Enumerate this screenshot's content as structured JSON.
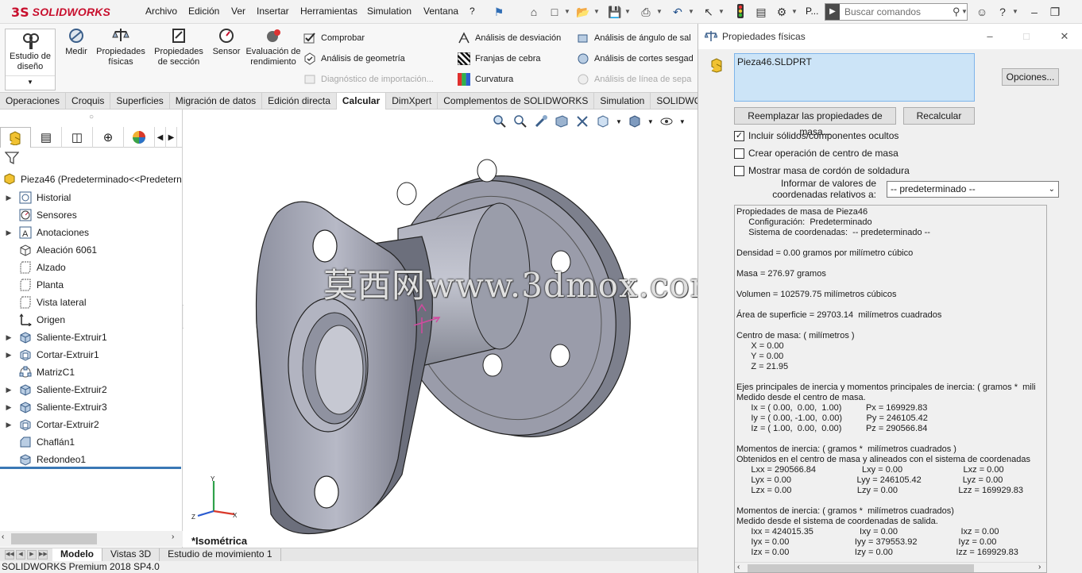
{
  "app": {
    "brand": "SOLIDWORKS",
    "logo_mark": "3S"
  },
  "menu": [
    "Archivo",
    "Edición",
    "Ver",
    "Insertar",
    "Herramientas",
    "Simulation",
    "Ventana",
    "?"
  ],
  "search": {
    "placeholder": "Buscar comandos"
  },
  "quick_label": "P...",
  "command_manager": {
    "estudio": "Estudio de diseño",
    "medir": "Medir",
    "propiedades_fisicas": "Propiedades físicas",
    "propiedades_seccion": "Propiedades de sección",
    "sensor": "Sensor",
    "evaluacion": "Evaluación de rendimiento",
    "col1": [
      "Comprobar",
      "Análisis de geometría",
      "Diagnóstico de importación..."
    ],
    "col2": [
      "Análisis de desviación",
      "Franjas de cebra",
      "Curvatura"
    ],
    "col3": [
      "Análisis de ángulo de sal",
      "Análisis de cortes sesgad",
      "Análisis de línea de sepa"
    ]
  },
  "command_tabs": [
    "Operaciones",
    "Croquis",
    "Superficies",
    "Migración de datos",
    "Edición directa",
    "Calcular",
    "DimXpert",
    "Complementos de SOLIDWORKS",
    "Simulation",
    "SOLIDWOR"
  ],
  "active_command_tab": "Calcular",
  "tree": {
    "root": "Pieza46  (Predeterminado<<Predetern",
    "items": [
      {
        "label": "Historial",
        "expandable": true,
        "icon": "history-icon"
      },
      {
        "label": "Sensores",
        "expandable": false,
        "icon": "sensor-icon"
      },
      {
        "label": "Anotaciones",
        "expandable": true,
        "icon": "annotation-icon"
      },
      {
        "label": "Aleación 6061",
        "expandable": false,
        "icon": "material-icon"
      },
      {
        "label": "Alzado",
        "expandable": false,
        "icon": "plane-icon"
      },
      {
        "label": "Planta",
        "expandable": false,
        "icon": "plane-icon"
      },
      {
        "label": "Vista lateral",
        "expandable": false,
        "icon": "plane-icon"
      },
      {
        "label": "Origen",
        "expandable": false,
        "icon": "origin-icon"
      },
      {
        "label": "Saliente-Extruir1",
        "expandable": true,
        "icon": "extrude-icon"
      },
      {
        "label": "Cortar-Extruir1",
        "expandable": true,
        "icon": "cut-extrude-icon"
      },
      {
        "label": "MatrizC1",
        "expandable": false,
        "icon": "pattern-icon"
      },
      {
        "label": "Saliente-Extruir2",
        "expandable": true,
        "icon": "extrude-icon"
      },
      {
        "label": "Saliente-Extruir3",
        "expandable": true,
        "icon": "extrude-icon"
      },
      {
        "label": "Cortar-Extruir2",
        "expandable": true,
        "icon": "cut-extrude-icon"
      },
      {
        "label": "Chaflán1",
        "expandable": false,
        "icon": "chamfer-icon"
      },
      {
        "label": "Redondeo1",
        "expandable": false,
        "icon": "fillet-icon"
      }
    ]
  },
  "bottom_tabs": [
    "Modelo",
    "Vistas 3D",
    "Estudio de movimiento 1"
  ],
  "active_bottom_tab": "Modelo",
  "status_bar": "SOLIDWORKS Premium 2018 SP4.0",
  "viewport": {
    "view_label": "*Isométrica",
    "watermark": "莫西网www.3dmox.com"
  },
  "dialog": {
    "title": "Propiedades físicas",
    "selection": "Pieza46.SLDPRT",
    "options_button": "Opciones...",
    "override_button": "Reemplazar las propiedades de masa...",
    "recalc_button": "Recalcular",
    "checkboxes": [
      {
        "label": "Incluir sólidos/componentes ocultos",
        "checked": true
      },
      {
        "label": "Crear operación de centro de masa",
        "checked": false
      },
      {
        "label": "Mostrar masa de cordón de soldadura",
        "checked": false
      }
    ],
    "coord_label": "Informar de valores de coordenadas relativos a:",
    "coord_value": "-- predeterminado --",
    "results": [
      "Propiedades de masa de Pieza46",
      "     Configuración:  Predeterminado",
      "     Sistema de coordenadas:  -- predeterminado --",
      "",
      "Densidad = 0.00 gramos por milímetro cúbico",
      "",
      "Masa = 276.97 gramos",
      "",
      "Volumen = 102579.75 milímetros cúbicos",
      "",
      "Área de superficie = 29703.14  milímetros cuadrados",
      "",
      "Centro de masa: ( milímetros )",
      "      X = 0.00",
      "      Y = 0.00",
      "      Z = 21.95",
      "",
      "Ejes principales de inercia y momentos principales de inercia: ( gramos *  mili",
      "Medido desde el centro de masa.",
      "      Ix = ( 0.00,  0.00,  1.00)          Px = 169929.83",
      "      Iy = ( 0.00, -1.00,  0.00)          Py = 246105.42",
      "      Iz = ( 1.00,  0.00,  0.00)          Pz = 290566.84",
      "",
      "Momentos de inercia: ( gramos *  milímetros cuadrados )",
      "Obtenidos en el centro de masa y alineados con el sistema de coordenadas",
      "      Lxx = 290566.84                   Lxy = 0.00                         Lxz = 0.00",
      "      Lyx = 0.00                           Lyy = 246105.42                 Lyz = 0.00",
      "      Lzx = 0.00                           Lzy = 0.00                         Lzz = 169929.83",
      "",
      "Momentos de inercia: ( gramos *  milímetros cuadrados)",
      "Medido desde el sistema de coordenadas de salida.",
      "      Ixx = 424015.35                   Ixy = 0.00                          Ixz = 0.00",
      "      Iyx = 0.00                           Iyy = 379553.92                 Iyz = 0.00",
      "      Izx = 0.00                           Izy = 0.00                          Izz = 169929.83"
    ]
  },
  "colors": {
    "accent": "#3a78b5",
    "brand": "#c8102e",
    "part_gray": "#8a8c99",
    "selection_bg": "#cce4f7"
  }
}
